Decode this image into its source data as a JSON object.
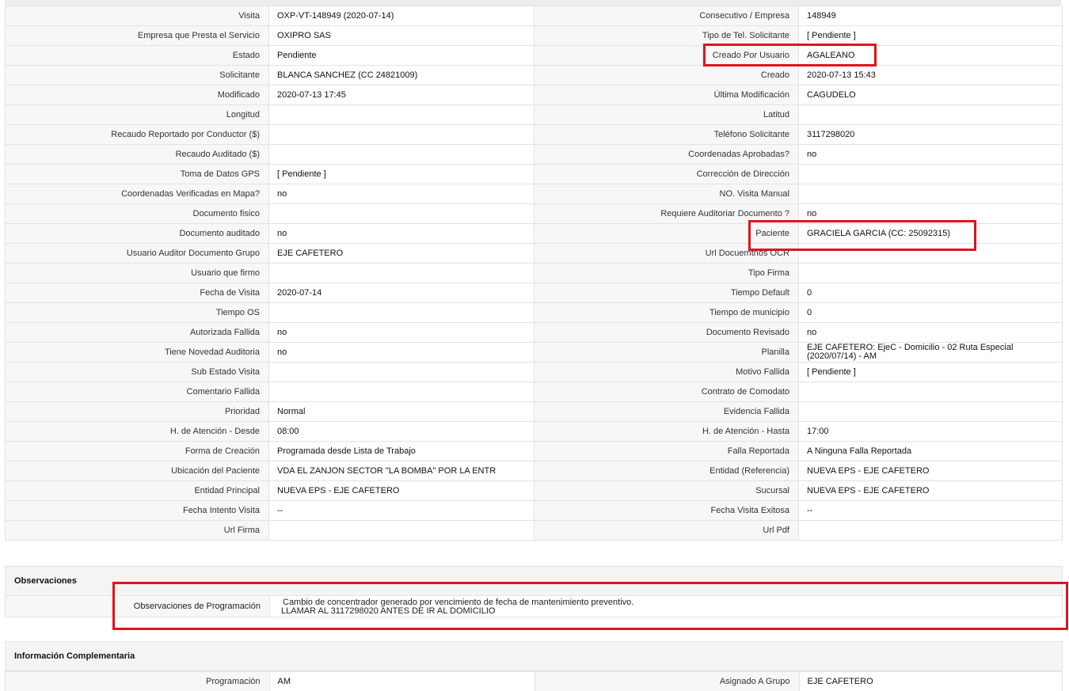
{
  "rows": [
    [
      {
        "label": "Visita",
        "value": "OXP-VT-148949 (2020-07-14)"
      },
      {
        "label": "Consecutivo / Empresa",
        "value": "148949"
      }
    ],
    [
      {
        "label": "Empresa que Presta el Servicio",
        "value": "OXIPRO SAS"
      },
      {
        "label": "Tipo de Tel. Solicitante",
        "value": "[ Pendiente ]"
      }
    ],
    [
      {
        "label": "Estado",
        "value": "Pendiente"
      },
      {
        "label": "Creado Por Usuario",
        "value": "AGALEANO"
      }
    ],
    [
      {
        "label": "Solicitante",
        "value": "BLANCA SANCHEZ (CC 24821009)"
      },
      {
        "label": "Creado",
        "value": "2020-07-13 15:43"
      }
    ],
    [
      {
        "label": "Modificado",
        "value": "2020-07-13 17:45"
      },
      {
        "label": "Última Modificación",
        "value": " CAGUDELO"
      }
    ],
    [
      {
        "label": "Longitud",
        "value": ""
      },
      {
        "label": "Latitud",
        "value": ""
      }
    ],
    [
      {
        "label": "Recaudo Reportado por Conductor ($)",
        "value": ""
      },
      {
        "label": "Teléfono Solicitante",
        "value": "3117298020"
      }
    ],
    [
      {
        "label": "Recaudo Auditado ($)",
        "value": ""
      },
      {
        "label": "Coordenadas Aprobadas?",
        "value": " no"
      }
    ],
    [
      {
        "label": "Toma de Datos GPS",
        "value": "[ Pendiente ]"
      },
      {
        "label": "Corrección de Dirección",
        "value": ""
      }
    ],
    [
      {
        "label": "Coordenadas Verificadas en Mapa?",
        "value": " no"
      },
      {
        "label": "NO. Visita Manual",
        "value": ""
      }
    ],
    [
      {
        "label": "Documento fisico",
        "value": ""
      },
      {
        "label": "Requiere Auditoriar Documento ?",
        "value": " no"
      }
    ],
    [
      {
        "label": "Documento auditado",
        "value": " no"
      },
      {
        "label": "Paciente",
        "value": "GRACIELA GARCIA (CC: 25092315)"
      }
    ],
    [
      {
        "label": "Usuario Auditor Documento Grupo",
        "value": "EJE CAFETERO"
      },
      {
        "label": "Url Docuemtnos OCR",
        "value": ""
      }
    ],
    [
      {
        "label": "Usuario que firmo",
        "value": ""
      },
      {
        "label": "Tipo Firma",
        "value": ""
      }
    ],
    [
      {
        "label": "Fecha de Visita",
        "value": " 2020-07-14"
      },
      {
        "label": "Tiempo Default",
        "value": "0"
      }
    ],
    [
      {
        "label": "Tiempo OS",
        "value": ""
      },
      {
        "label": "Tiempo de municipio",
        "value": "0"
      }
    ],
    [
      {
        "label": "Autorizada Fallida",
        "value": " no"
      },
      {
        "label": "Documento Revisado",
        "value": " no"
      }
    ],
    [
      {
        "label": "Tiene Novedad Auditoria",
        "value": " no"
      },
      {
        "label": "Planilla",
        "value": "EJE CAFETERO: EjeC - Domicilio - 02 Ruta Especial (2020/07/14) - AM"
      }
    ],
    [
      {
        "label": "Sub Estado Visita",
        "value": ""
      },
      {
        "label": "Motivo Fallida",
        "value": "[ Pendiente ]"
      }
    ],
    [
      {
        "label": "Comentario Fallida",
        "value": ""
      },
      {
        "label": "Contrato de Comodato",
        "value": ""
      }
    ],
    [
      {
        "label": "Prioridad",
        "value": "Normal"
      },
      {
        "label": "Evidencia Fallida",
        "value": ""
      }
    ],
    [
      {
        "label": "H. de Atención - Desde",
        "value": "08:00"
      },
      {
        "label": "H. de Atención - Hasta",
        "value": "17:00"
      }
    ],
    [
      {
        "label": "Forma de Creación",
        "value": "Programada desde Lista de Trabajo"
      },
      {
        "label": "Falla Reportada",
        "value": "A Ninguna Falla Reportada"
      }
    ],
    [
      {
        "label": "Ubicación del Paciente",
        "value": "VDA EL ZANJON SECTOR \"LA BOMBA\" POR LA ENTR"
      },
      {
        "label": "Entidad (Referencia)",
        "value": "NUEVA EPS - EJE CAFETERO"
      }
    ],
    [
      {
        "label": "Entidad Principal",
        "value": "NUEVA EPS - EJE CAFETERO"
      },
      {
        "label": "Sucursal",
        "value": "NUEVA EPS - EJE CAFETERO"
      }
    ],
    [
      {
        "label": "Fecha Intento Visita",
        "value": " --"
      },
      {
        "label": "Fecha Visita Exitosa",
        "value": " --"
      }
    ],
    [
      {
        "label": "Url Firma",
        "value": ""
      },
      {
        "label": "Url Pdf",
        "value": ""
      }
    ]
  ],
  "observaciones": {
    "title": "Observaciones",
    "label": "Observaciones de Programación",
    "line1": "Cambio de concentrador generado por vencimiento de fecha de mantenimiento preventivo.",
    "line2": "LLAMAR AL 3117298020 ANTES DE IR AL DOMICILIO"
  },
  "complementaria": {
    "title": "Información Complementaria",
    "row": [
      {
        "label": "Programación",
        "value": "AM"
      },
      {
        "label": "Asignado A Grupo",
        "value": "EJE CAFETERO"
      }
    ]
  },
  "highlight_color": "#e0141e"
}
